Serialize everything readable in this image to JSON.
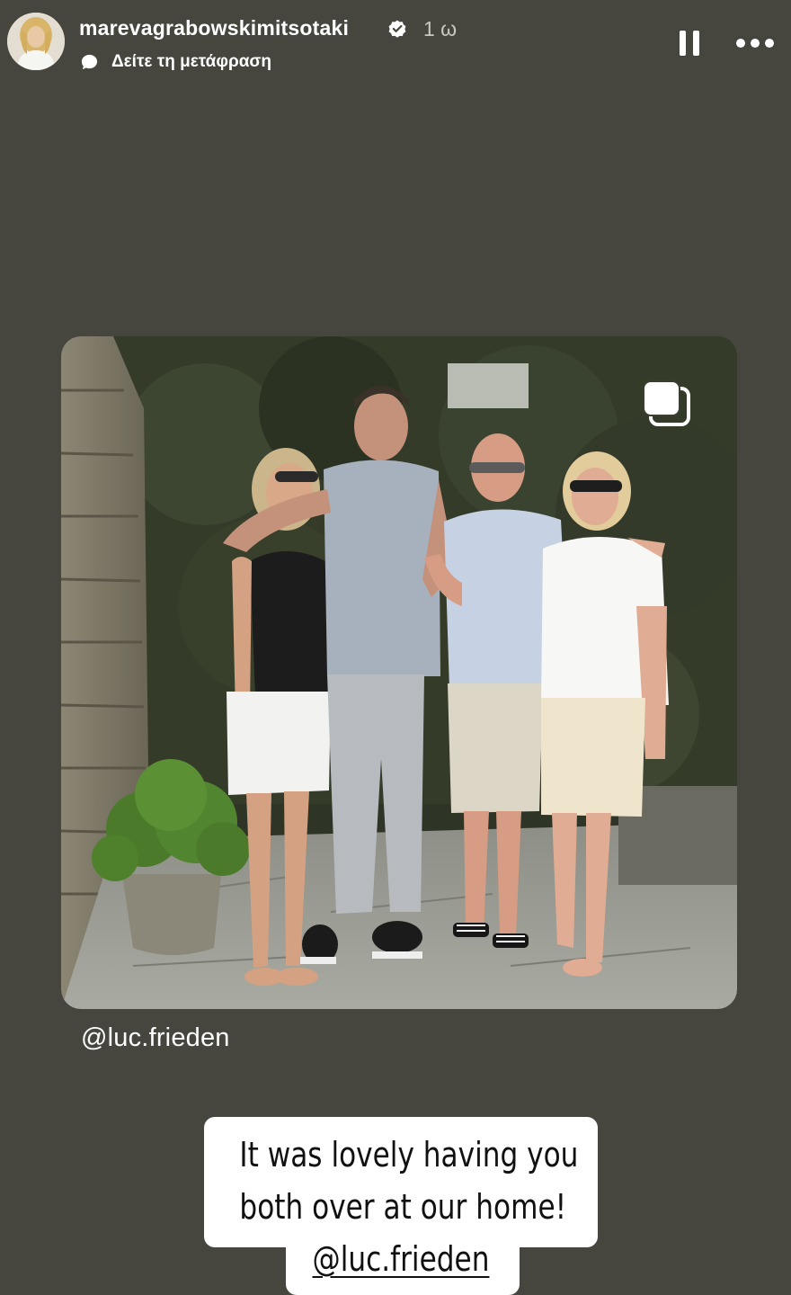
{
  "header": {
    "username": "marevagrabowskimitsotaki",
    "timestamp": "1 ω",
    "translate_label": "Δείτε τη μετάφραση",
    "icons": {
      "verified": "verified-badge-icon",
      "translate": "speech-bubble-icon",
      "pause": "pause-icon",
      "more": "more-options-icon"
    }
  },
  "post": {
    "mention": "@luc.frieden",
    "multi_image_icon": "multi-image-icon"
  },
  "sticker": {
    "line1": "It was lovely having you",
    "line2": "both over at our home!",
    "mention": "@luc.frieden"
  },
  "colors": {
    "background": "#46463f",
    "text": "#ffffff",
    "sticker_bg": "#ffffff",
    "sticker_text": "#111111"
  }
}
